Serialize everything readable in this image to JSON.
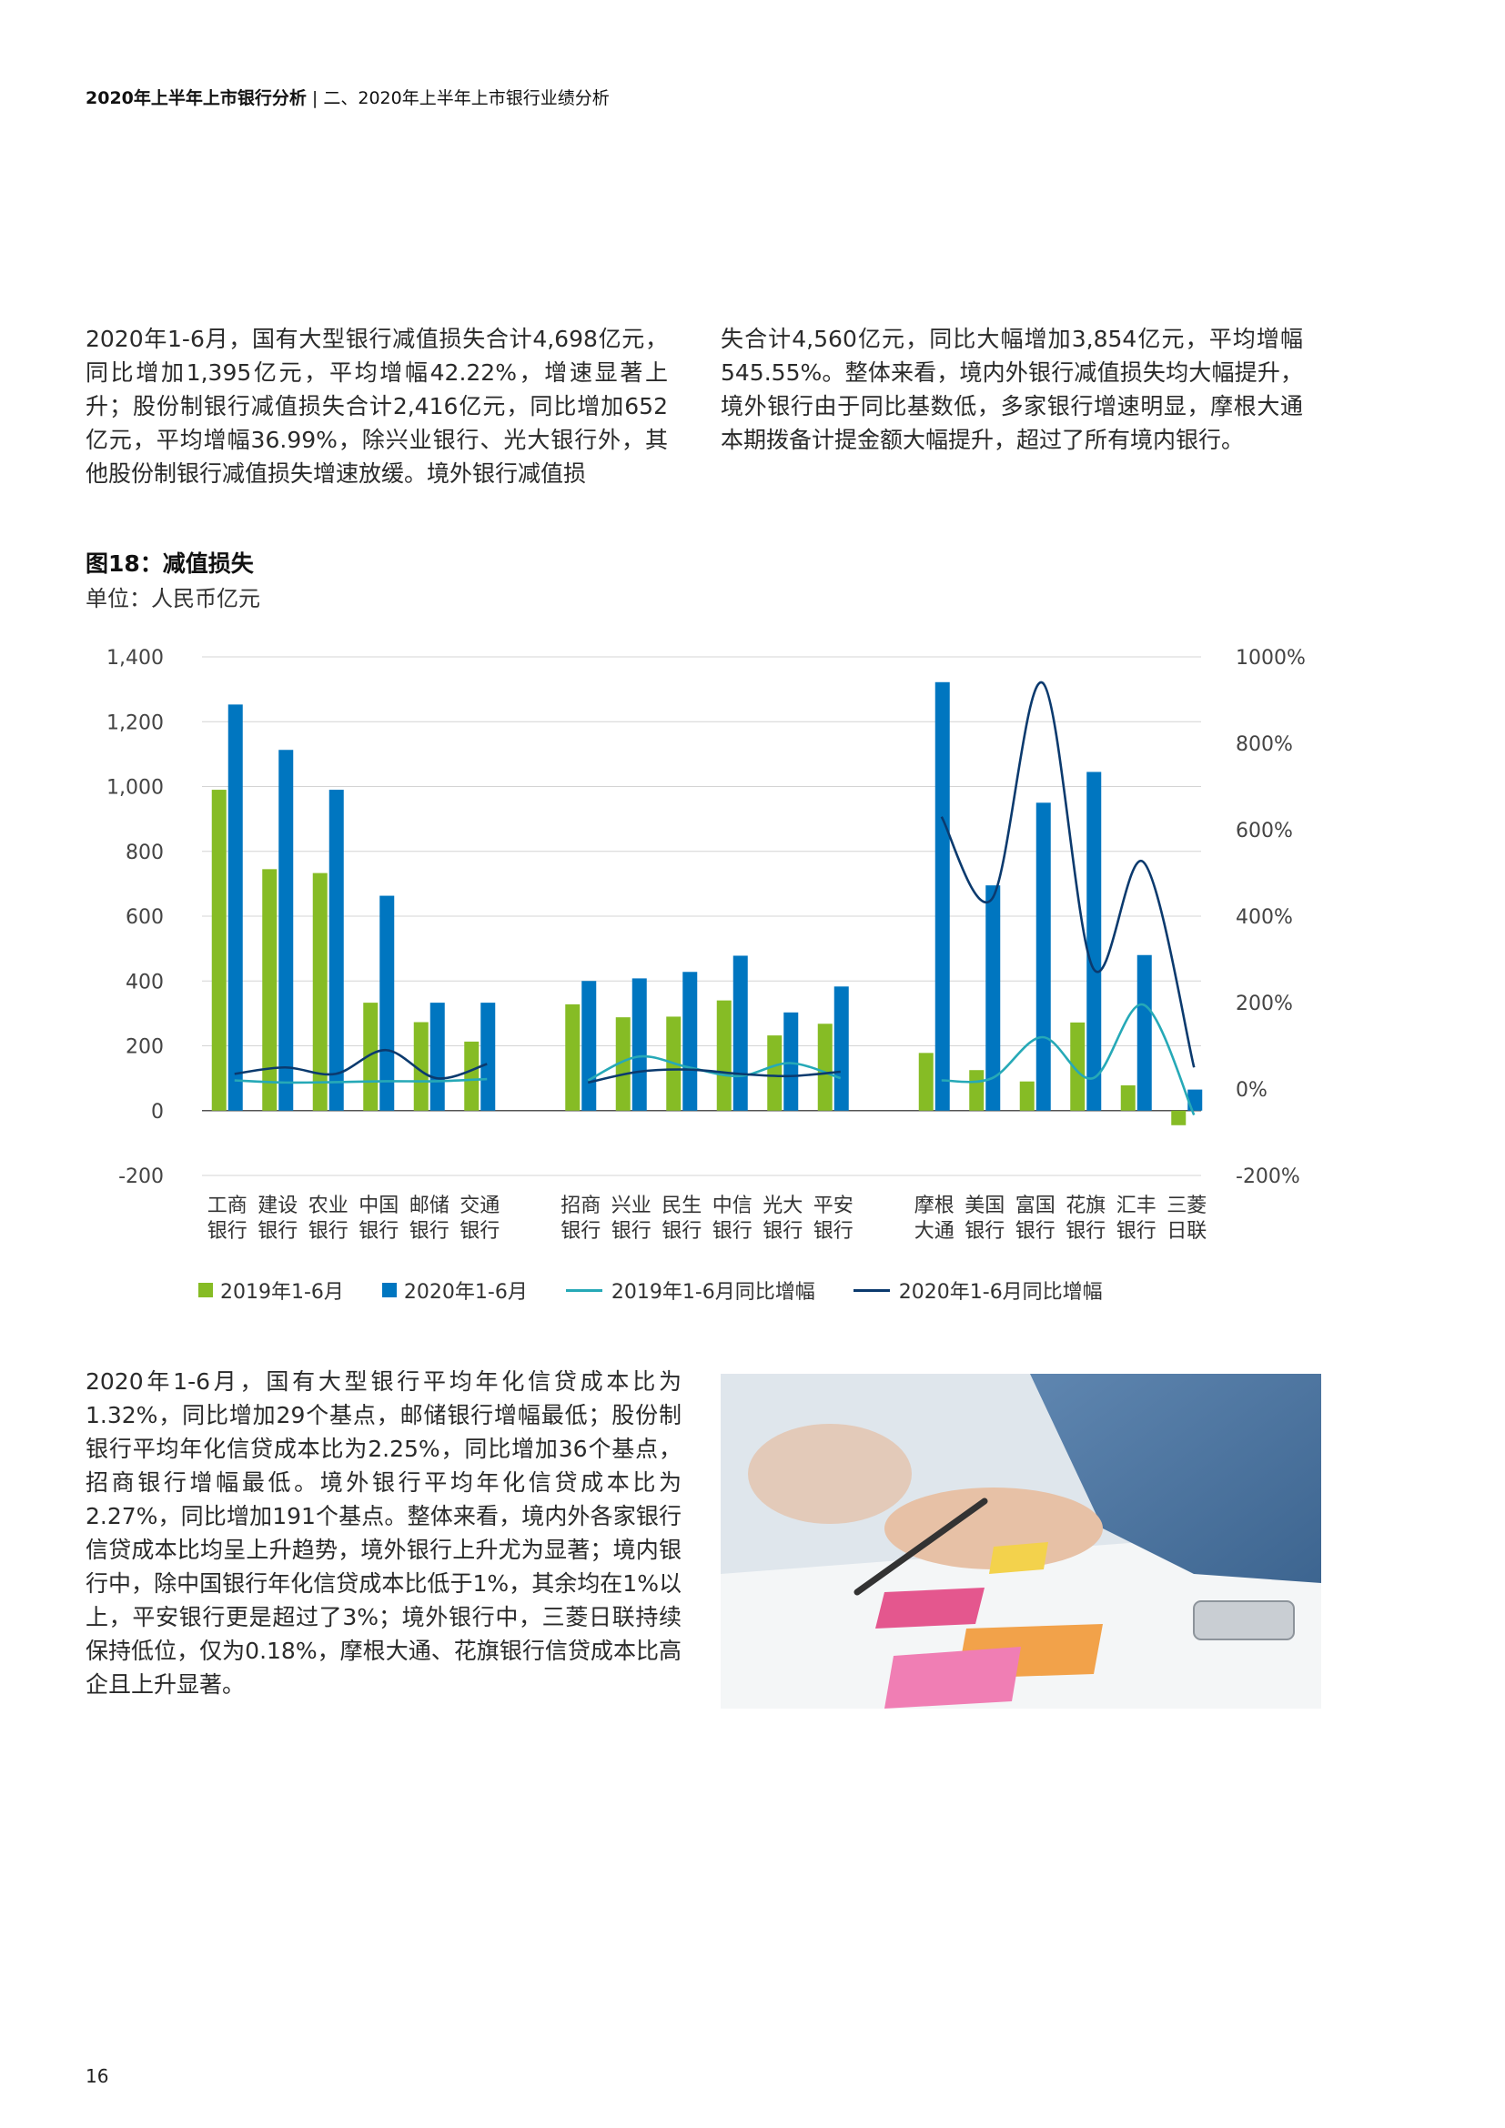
{
  "header": {
    "title": "2020年上半年上市银行分析",
    "separator": " | ",
    "section": "二、2020年上半年上市银行业绩分析"
  },
  "para1_left": "2020年1-6月，国有大型银行减值损失合计4,698亿元，同比增加1,395亿元，平均增幅42.22%，增速显著上升；股份制银行减值损失合计2,416亿元，同比增加652亿元，平均增幅36.99%，除兴业银行、光大银行外，其他股份制银行减值损失增速放缓。境外银行减值损",
  "para1_right": "失合计4,560亿元，同比大幅增加3,854亿元，平均增幅545.55%。整体来看，境内外银行减值损失均大幅提升，境外银行由于同比基数低，多家银行增速明显，摩根大通本期拨备计提金额大幅提升，超过了所有境内银行。",
  "figure": {
    "title": "图18：减值损失",
    "unit": "单位：人民币亿元"
  },
  "chart_data": {
    "type": "bar",
    "categories": [
      [
        "工商",
        "银行"
      ],
      [
        "建设",
        "银行"
      ],
      [
        "农业",
        "银行"
      ],
      [
        "中国",
        "银行"
      ],
      [
        "邮储",
        "银行"
      ],
      [
        "交通",
        "银行"
      ],
      [
        "招商",
        "银行"
      ],
      [
        "兴业",
        "银行"
      ],
      [
        "民生",
        "银行"
      ],
      [
        "中信",
        "银行"
      ],
      [
        "光大",
        "银行"
      ],
      [
        "平安",
        "银行"
      ],
      [
        "摩根",
        "大通"
      ],
      [
        "美国",
        "银行"
      ],
      [
        "富国",
        "银行"
      ],
      [
        "花旗",
        "银行"
      ],
      [
        "汇丰",
        "银行"
      ],
      [
        "三菱",
        "日联"
      ]
    ],
    "groups": [
      [
        0,
        1,
        2,
        3,
        4,
        5
      ],
      [
        6,
        7,
        8,
        9,
        10,
        11
      ],
      [
        12,
        13,
        14,
        15,
        16,
        17
      ]
    ],
    "series": [
      {
        "name": "2019年1-6月",
        "kind": "bar",
        "color": "#86bc25",
        "values": [
          990,
          745,
          733,
          333,
          273,
          213,
          328,
          288,
          290,
          340,
          232,
          268,
          178,
          125,
          90,
          272,
          78,
          -45
        ]
      },
      {
        "name": "2020年1-6月",
        "kind": "bar",
        "color": "#0076c0",
        "values": [
          1253,
          1113,
          990,
          663,
          333,
          333,
          400,
          408,
          428,
          478,
          303,
          383,
          1322,
          695,
          950,
          1045,
          480,
          65
        ]
      },
      {
        "name": "2019年1-6月同比增幅",
        "kind": "line",
        "axis": "right",
        "color": "#26a9b7",
        "values": [
          20,
          15,
          16,
          18,
          18,
          23,
          20,
          75,
          50,
          30,
          60,
          25,
          20,
          25,
          120,
          25,
          195,
          -60
        ]
      },
      {
        "name": "2020年1-6月同比增幅",
        "kind": "line",
        "axis": "right",
        "color": "#0b3a6e",
        "values": [
          35,
          50,
          35,
          90,
          25,
          58,
          15,
          40,
          45,
          35,
          30,
          40,
          630,
          440,
          940,
          280,
          525,
          50
        ]
      }
    ],
    "y_left": {
      "min": -200,
      "max": 1400,
      "ticks": [
        -200,
        0,
        200,
        400,
        600,
        800,
        1000,
        1200,
        1400
      ],
      "tick_labels": [
        "-200",
        "0",
        "200",
        "400",
        "600",
        "800",
        "1,000",
        "1,200",
        "1,400"
      ]
    },
    "y_right": {
      "min": -200,
      "max": 1000,
      "ticks": [
        -200,
        0,
        200,
        400,
        600,
        800,
        1000
      ],
      "tick_labels": [
        "-200%",
        "0%",
        "200%",
        "400%",
        "600%",
        "800%",
        "1000%"
      ]
    },
    "grid": true,
    "legend_position": "bottom"
  },
  "para2": "2020年1-6月，国有大型银行平均年化信贷成本比为1.32%，同比增加29个基点，邮储银行增幅最低；股份制银行平均年化信贷成本比为2.25%，同比增加36个基点，招商银行增幅最低。境外银行平均年化信贷成本比为2.27%，同比增加191个基点。整体来看，境内外各家银行信贷成本比均呈上升趋势，境外银行上升尤为显著；境内银行中，除中国银行年化信贷成本比低于1%，其余均在1%以上，平安银行更是超过了3%；境外银行中，三菱日联持续保持低位，仅为0.18%，摩根大通、花旗银行信贷成本比高企且上升显著。",
  "page_number": "16"
}
